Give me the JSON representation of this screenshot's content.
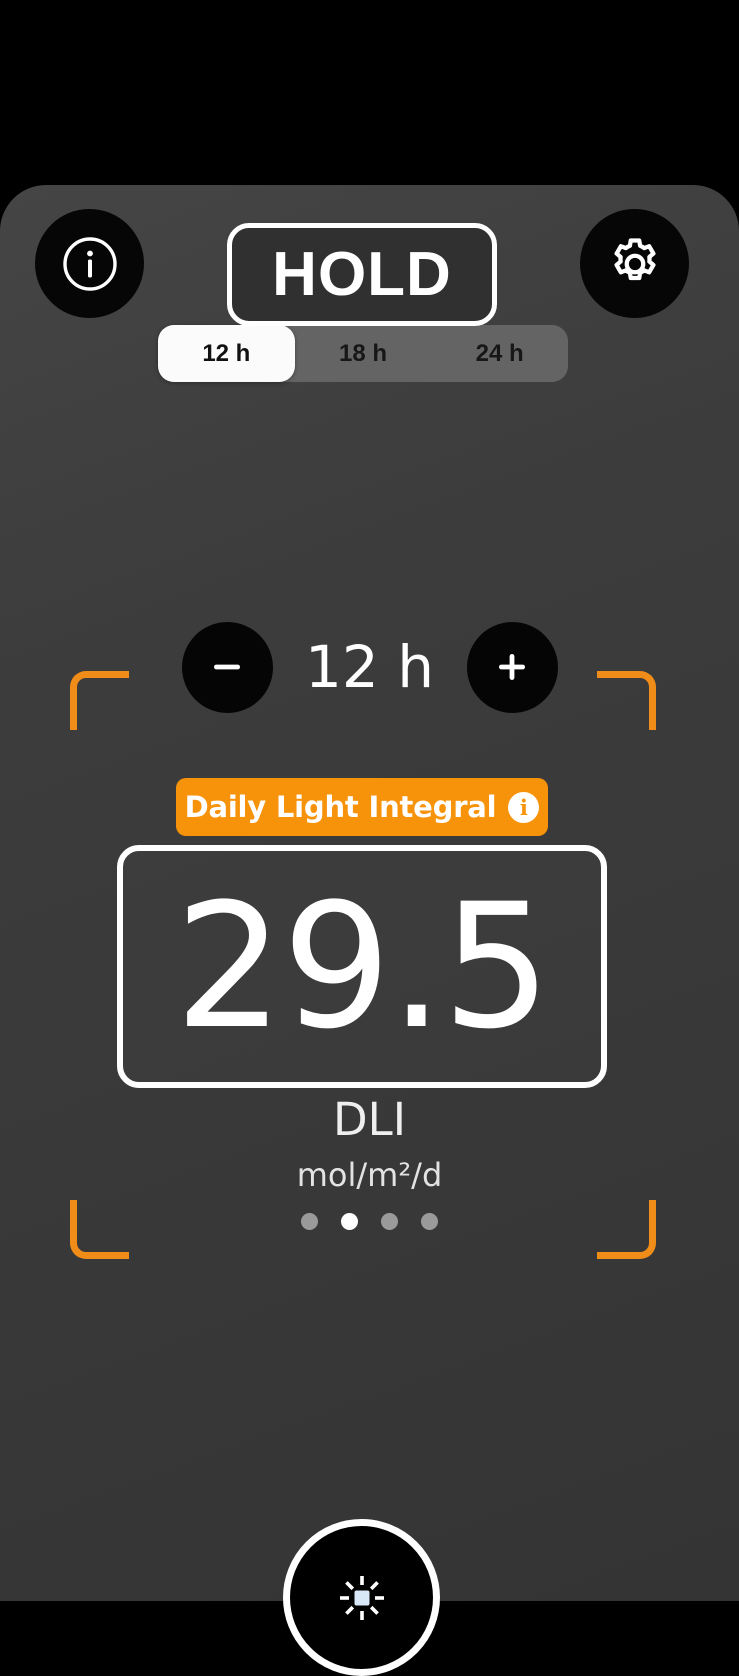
{
  "app": {
    "background_color": "#000000",
    "card_color": "#3a3a3a",
    "accent_color": "#F7930B"
  },
  "top_bar": {
    "info_button": {
      "icon": "info-circle-icon",
      "label": "i"
    },
    "settings_button": {
      "icon": "gear-icon"
    },
    "mode_button": {
      "label": "HOLD",
      "state": "active"
    }
  },
  "duration_segmented": {
    "selected": "12 h",
    "options": [
      {
        "label": "12 h",
        "selected": true
      },
      {
        "label": "18 h",
        "selected": false
      },
      {
        "label": "24 h",
        "selected": false
      }
    ]
  },
  "duration_stepper": {
    "decrement_label": "−",
    "value": "12 h",
    "increment_label": "+"
  },
  "measurement": {
    "badge_label": "Daily Light Integral",
    "badge_info_icon": "info-circle-icon",
    "badge_info_label": "i",
    "value": "29.5",
    "name": "DLI",
    "units": "mol/m²/d",
    "bracket_color": "#F08C18"
  },
  "pagination": {
    "total": 4,
    "active_index": 1
  },
  "bottom_bar": {
    "light_button": {
      "icon": "brightness-sun-icon",
      "center_color": "#d9e8f7",
      "ray_color": "#ffffff"
    }
  }
}
